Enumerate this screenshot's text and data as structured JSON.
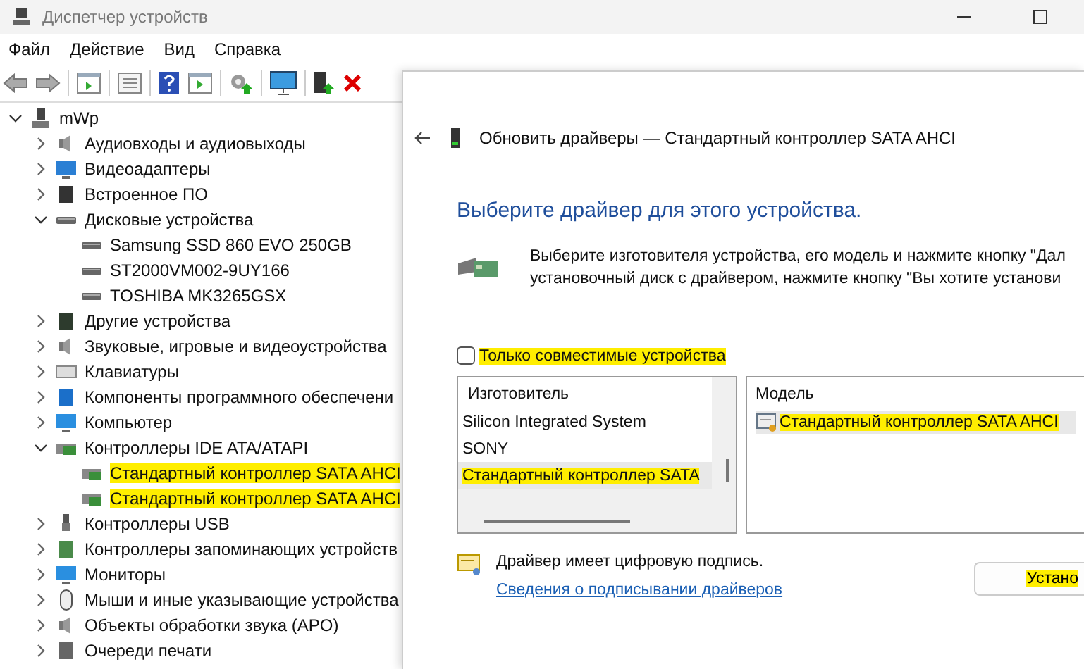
{
  "window": {
    "title": "Диспетчер устройств"
  },
  "menu": [
    "Файл",
    "Действие",
    "Вид",
    "Справка"
  ],
  "tree": {
    "label": "mWp",
    "expanded": true,
    "children": [
      {
        "label": "Аудиовходы и аудиовыходы",
        "kind": "audio",
        "expanded": false,
        "highlighted": false
      },
      {
        "label": "Видеоадаптеры",
        "kind": "display",
        "expanded": false,
        "highlighted": false
      },
      {
        "label": "Встроенное ПО",
        "kind": "firmware",
        "expanded": false,
        "highlighted": false
      },
      {
        "label": "Дисковые устройства",
        "kind": "disk",
        "expanded": true,
        "highlighted": false,
        "children": [
          {
            "label": "Samsung SSD 860 EVO 250GB",
            "kind": "disk",
            "highlighted": false
          },
          {
            "label": "ST2000VM002-9UY166",
            "kind": "disk",
            "highlighted": false
          },
          {
            "label": "TOSHIBA MK3265GSX",
            "kind": "disk",
            "highlighted": false
          }
        ]
      },
      {
        "label": "Другие устройства",
        "kind": "other",
        "expanded": false,
        "highlighted": false
      },
      {
        "label": "Звуковые, игровые и видеоустройства",
        "kind": "audio",
        "expanded": false,
        "highlighted": false
      },
      {
        "label": "Клавиатуры",
        "kind": "keyboard",
        "expanded": false,
        "highlighted": false
      },
      {
        "label": "Компоненты программного обеспечени",
        "kind": "software",
        "expanded": false,
        "highlighted": false
      },
      {
        "label": "Компьютер",
        "kind": "monitor",
        "expanded": false,
        "highlighted": false
      },
      {
        "label": "Контроллеры IDE ATA/ATAPI",
        "kind": "controller",
        "expanded": true,
        "highlighted": false,
        "children": [
          {
            "label": "Стандартный контроллер SATA AHCI",
            "kind": "controller",
            "highlighted": true
          },
          {
            "label": "Стандартный контроллер SATA AHCI",
            "kind": "controller",
            "highlighted": true
          }
        ]
      },
      {
        "label": "Контроллеры USB",
        "kind": "usb",
        "expanded": false,
        "highlighted": false
      },
      {
        "label": "Контроллеры запоминающих устройств",
        "kind": "storage",
        "expanded": false,
        "highlighted": false
      },
      {
        "label": "Мониторы",
        "kind": "monitor",
        "expanded": false,
        "highlighted": false
      },
      {
        "label": "Мыши и иные указывающие устройства",
        "kind": "mouse",
        "expanded": false,
        "highlighted": false
      },
      {
        "label": "Объекты обработки звука (APO)",
        "kind": "audio",
        "expanded": false,
        "highlighted": false
      },
      {
        "label": "Очереди печати",
        "kind": "printer",
        "expanded": false,
        "highlighted": false
      }
    ]
  },
  "dialog": {
    "title": "Обновить драйверы — Стандартный контроллер SATA AHCI",
    "heading": "Выберите драйвер для этого устройства.",
    "instructions": [
      "Выберите изготовителя устройства, его модель и нажмите кнопку \"Дал",
      "установочный диск с драйвером, нажмите кнопку \"Вы хотите установи"
    ],
    "compatible_checkbox": {
      "label": "Только совместимые устройства",
      "checked": false,
      "highlighted": true
    },
    "manufacturer_list": {
      "header": "Изготовитель",
      "items": [
        {
          "label": "Silicon Integrated System",
          "selected": false,
          "highlighted": false
        },
        {
          "label": "SONY",
          "selected": false,
          "highlighted": false
        },
        {
          "label": "Стандартный контроллер SATA",
          "selected": true,
          "highlighted": true
        }
      ]
    },
    "model_list": {
      "header": "Модель",
      "items": [
        {
          "label": "Стандартный контроллер SATA AHCI",
          "selected": true,
          "highlighted": true
        }
      ]
    },
    "signature_text": "Драйвер имеет цифровую подпись.",
    "signature_link": "Сведения о подписывании драйверов",
    "install_button": {
      "label": "Устано",
      "highlighted": true
    }
  }
}
